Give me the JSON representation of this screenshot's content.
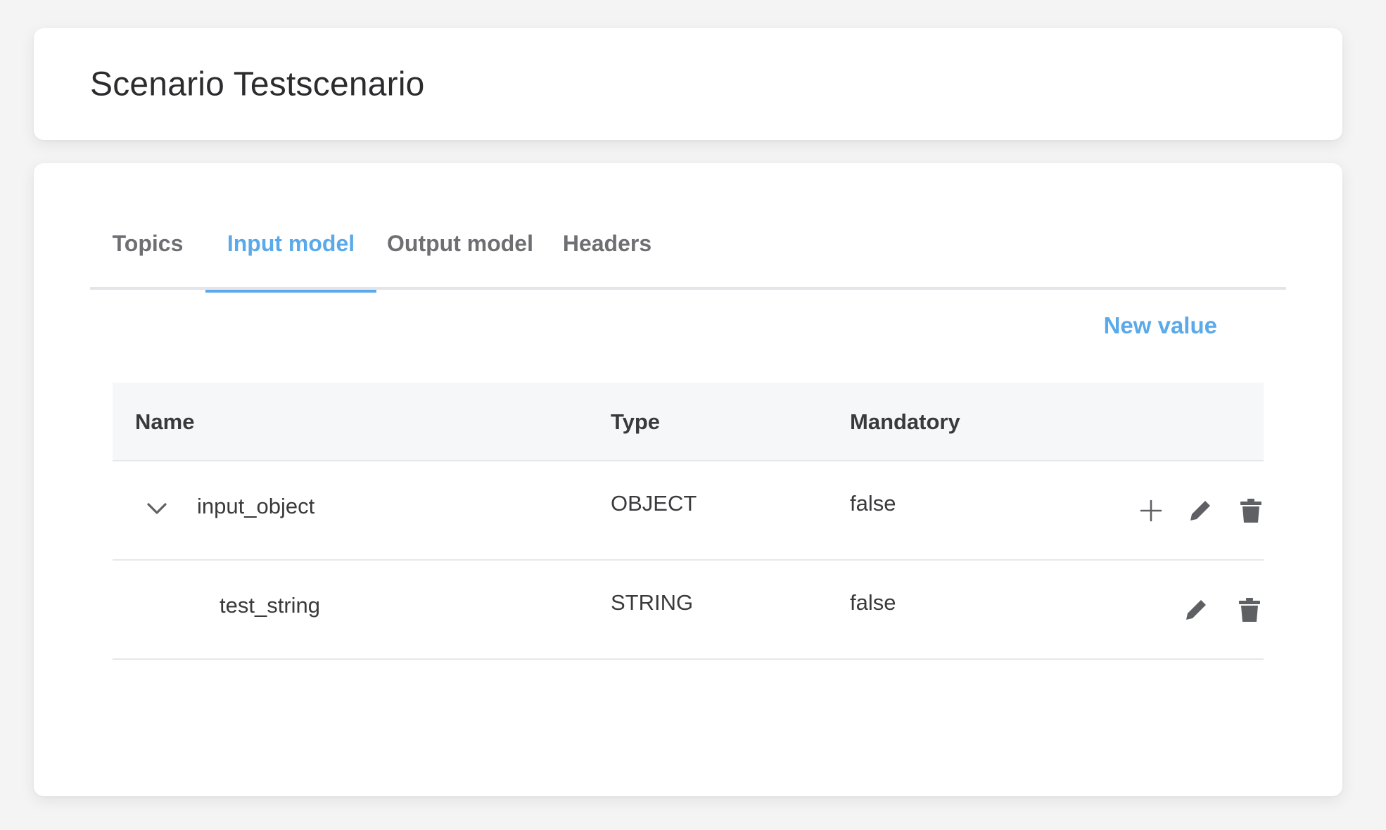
{
  "header": {
    "title": "Scenario Testscenario"
  },
  "tabs": [
    {
      "label": "Topics",
      "active": false
    },
    {
      "label": "Input model",
      "active": true
    },
    {
      "label": "Output model",
      "active": false
    },
    {
      "label": "Headers",
      "active": false
    }
  ],
  "actions": {
    "new_value_label": "New value"
  },
  "table": {
    "columns": [
      "Name",
      "Type",
      "Mandatory"
    ],
    "rows": [
      {
        "name": "input_object",
        "type": "OBJECT",
        "mandatory": "false",
        "expandable": true,
        "expanded": true
      },
      {
        "name": "test_string",
        "type": "STRING",
        "mandatory": "false",
        "expandable": false
      }
    ]
  },
  "icons": {
    "expand": "chevron-down-icon",
    "add": "plus-icon",
    "edit": "pencil-icon",
    "delete": "trash-icon"
  },
  "colors": {
    "accent": "#5aa9ea",
    "background": "#f4f4f5",
    "card": "#ffffff",
    "text": "#3a3a3c",
    "muted": "#6e6e73",
    "icon": "#5f6064"
  }
}
